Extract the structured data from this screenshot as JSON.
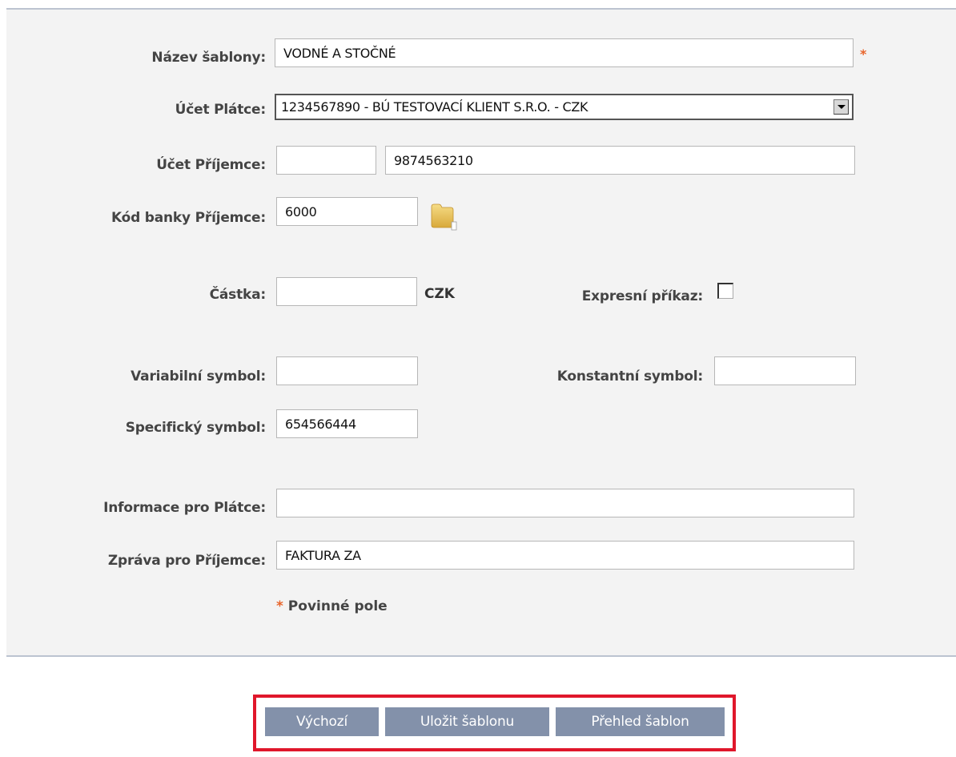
{
  "form": {
    "template_name": {
      "label": "Název šablony:",
      "value": "VODNÉ A STOČNÉ",
      "required_mark": "*"
    },
    "payer_account": {
      "label": "Účet Plátce:",
      "value": "1234567890 - BÚ TESTOVACÍ KLIENT S.R.O. - CZK"
    },
    "payee_account": {
      "label": "Účet Příjemce:",
      "prefix": "",
      "number": "9874563210"
    },
    "payee_bank_code": {
      "label": "Kód banky Příjemce:",
      "value": "6000",
      "icon": "folder-icon"
    },
    "amount": {
      "label": "Částka:",
      "value": "",
      "currency": "CZK"
    },
    "express_order": {
      "label": "Expresní příkaz:",
      "checked": false
    },
    "variable_symbol": {
      "label": "Variabilní symbol:",
      "value": ""
    },
    "constant_symbol": {
      "label": "Konstantní symbol:",
      "value": ""
    },
    "specific_symbol": {
      "label": "Specifický symbol:",
      "value": "654566444"
    },
    "payer_info": {
      "label": "Informace pro Plátce:",
      "value": ""
    },
    "payee_message": {
      "label": "Zpráva pro Příjemce:",
      "value": "FAKTURA ZA"
    },
    "required_note": {
      "star": "*",
      "text": " Povinné pole"
    }
  },
  "buttons": {
    "default": "Výchozí",
    "save_template": "Uložit šablonu",
    "template_overview": "Přehled šablon"
  },
  "colors": {
    "accent_required": "#e8642a",
    "button_bg": "#8391aa",
    "highlight_frame": "#e0172b",
    "panel_bg": "#f3f3f3"
  }
}
